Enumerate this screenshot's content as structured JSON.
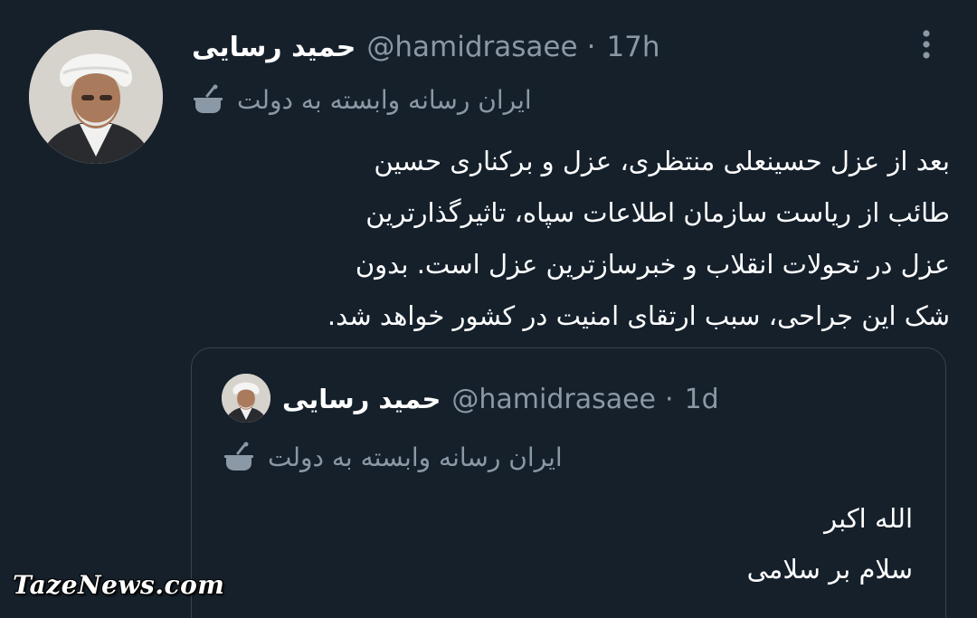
{
  "tweet": {
    "author": {
      "display_name": "حمید رسایی",
      "handle": "@hamidrasaee",
      "separator": "·",
      "time": "17h"
    },
    "state_label": "ایران رسانه وابسته به دولت",
    "body_lines": [
      "بعد از عزل حسینعلی منتظری، عزل و برکناری حسین",
      "طائب از ریاست سازمان اطلاعات سپاه، تاثیرگذارترین",
      "عزل در تحولات انقلاب و خبرسازترین عزل است. بدون",
      "شک این جراحی، سبب ارتقای امنیت در کشور خواهد شد."
    ],
    "more_icon": "more-vertical-icon"
  },
  "quoted_tweet": {
    "author": {
      "display_name": "حمید رسایی",
      "handle": "@hamidrasaee",
      "separator": "·",
      "time": "1d"
    },
    "state_label": "ایران رسانه وابسته به دولت",
    "body_lines": [
      "الله اکبر",
      "سلام بر سلامی"
    ]
  },
  "watermark": "TazeNews.com",
  "colors": {
    "background": "#15202b",
    "primary_text": "#ffffff",
    "secondary_text": "#8b98a5",
    "border": "#38444d"
  }
}
